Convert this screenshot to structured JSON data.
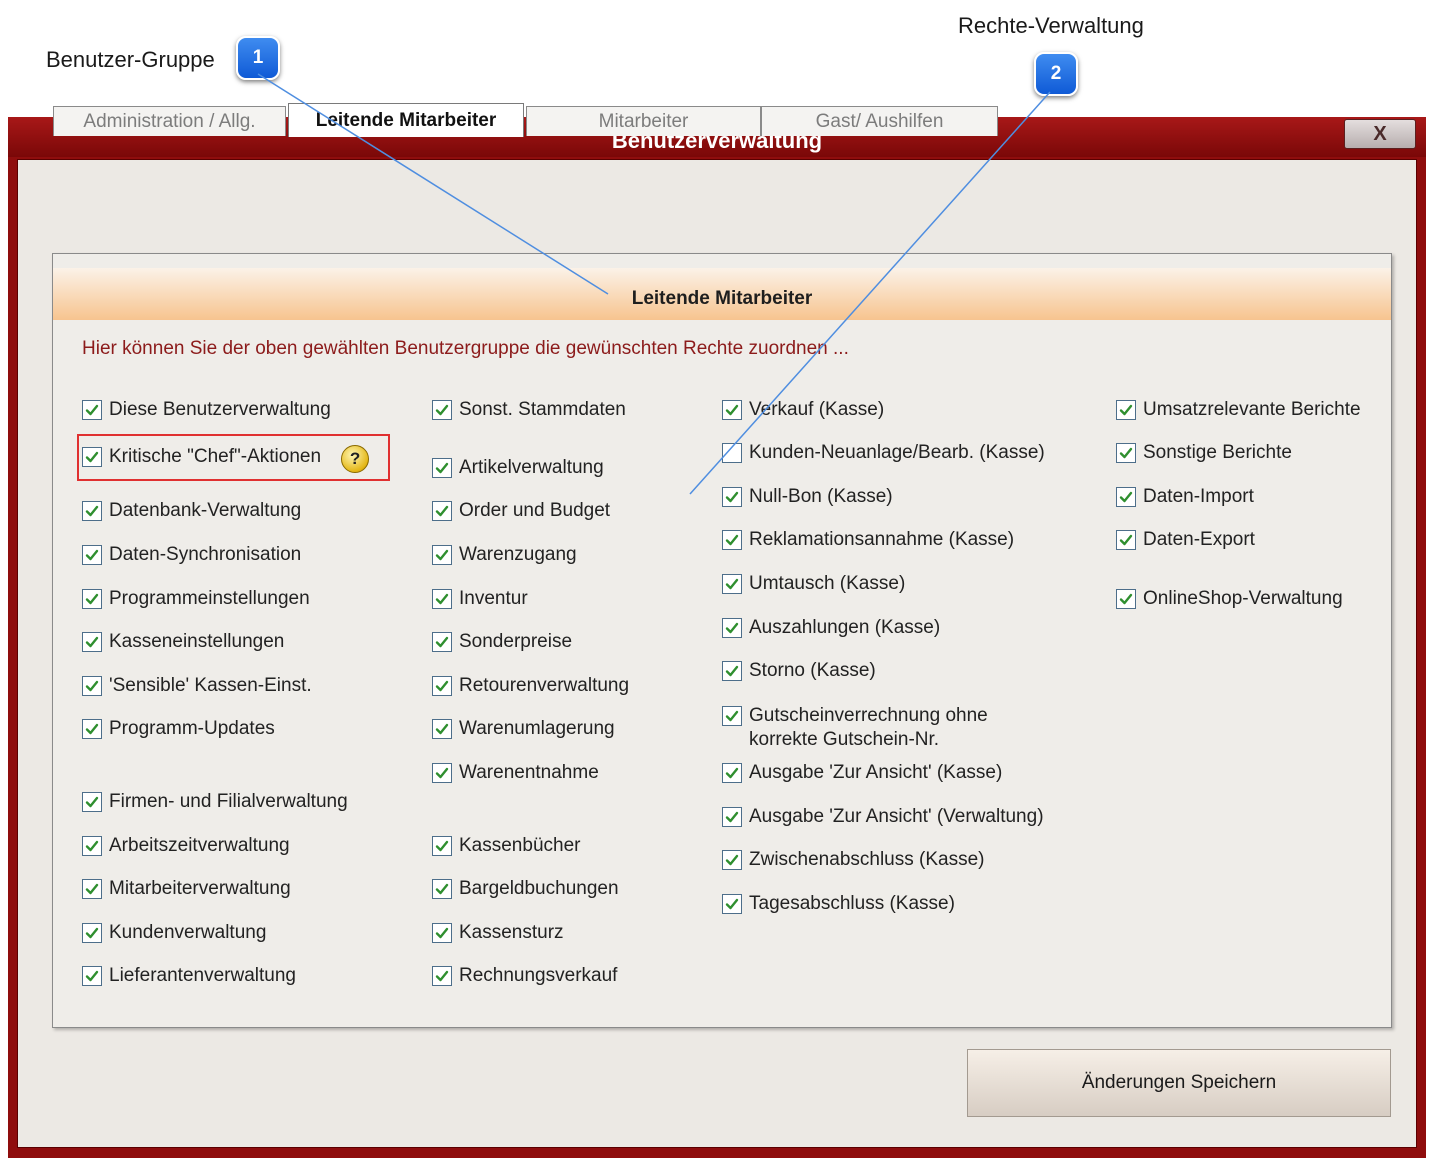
{
  "callouts": [
    {
      "number": "1",
      "label": "Benutzer-Gruppe"
    },
    {
      "number": "2",
      "label": "Rechte-Verwaltung"
    }
  ],
  "window": {
    "title": "Benutzerverwaltung",
    "close_glyph": "X"
  },
  "tabs": [
    {
      "label": "Administration / Allg.",
      "active": false
    },
    {
      "label": "Leitende Mitarbeiter",
      "active": true
    },
    {
      "label": "Mitarbeiter",
      "active": false
    },
    {
      "label": "Gast/ Aushilfen",
      "active": false
    }
  ],
  "panel": {
    "header": "Leitende Mitarbeiter",
    "hint": "Hier können Sie der oben gewählten Benutzergruppe die gewünschten  Rechte zuordnen ..."
  },
  "columns": [
    [
      {
        "label": "Diese Benutzerverwaltung",
        "checked": true
      },
      {
        "label": "Kritische \"Chef\"-Aktionen",
        "checked": true,
        "help_icon": "question-help-icon",
        "highlighted": true
      },
      {
        "label": "Datenbank-Verwaltung",
        "checked": true
      },
      {
        "label": "Daten-Synchronisation",
        "checked": true
      },
      {
        "label": "Programmeinstellungen",
        "checked": true
      },
      {
        "label": "Kasseneinstellungen",
        "checked": true
      },
      {
        "label": "'Sensible' Kassen-Einst.",
        "checked": true
      },
      {
        "label": "Programm-Updates",
        "checked": true
      },
      {
        "label": "Firmen- und Filialverwaltung",
        "checked": true
      },
      {
        "label": "Arbeitszeitverwaltung",
        "checked": true
      },
      {
        "label": "Mitarbeiterverwaltung",
        "checked": true
      },
      {
        "label": "Kundenverwaltung",
        "checked": true
      },
      {
        "label": "Lieferantenverwaltung",
        "checked": true
      }
    ],
    [
      {
        "label": "Sonst. Stammdaten",
        "checked": true
      },
      {
        "label": "Artikelverwaltung",
        "checked": true
      },
      {
        "label": "Order und Budget",
        "checked": true
      },
      {
        "label": "Warenzugang",
        "checked": true
      },
      {
        "label": "Inventur",
        "checked": true
      },
      {
        "label": "Sonderpreise",
        "checked": true
      },
      {
        "label": "Retourenverwaltung",
        "checked": true
      },
      {
        "label": "Warenumlagerung",
        "checked": true
      },
      {
        "label": "Warenentnahme",
        "checked": true
      },
      {
        "label": "Kassenbücher",
        "checked": true
      },
      {
        "label": "Bargeldbuchungen",
        "checked": true
      },
      {
        "label": "Kassensturz",
        "checked": true
      },
      {
        "label": "Rechnungsverkauf",
        "checked": true
      }
    ],
    [
      {
        "label": "Verkauf (Kasse)",
        "checked": true
      },
      {
        "label": "Kunden-Neuanlage/Bearb. (Kasse)",
        "checked": false
      },
      {
        "label": "Null-Bon (Kasse)",
        "checked": true
      },
      {
        "label": "Reklamationsannahme (Kasse)",
        "checked": true
      },
      {
        "label": "Umtausch (Kasse)",
        "checked": true
      },
      {
        "label": "Auszahlungen (Kasse)",
        "checked": true
      },
      {
        "label": "Storno (Kasse)",
        "checked": true
      },
      {
        "label": "Gutscheinverrechnung ohne korrekte Gutschein-Nr.",
        "checked": true
      },
      {
        "label": "Ausgabe 'Zur Ansicht' (Kasse)",
        "checked": true
      },
      {
        "label": "Ausgabe 'Zur Ansicht' (Verwaltung)",
        "checked": true
      },
      {
        "label": "Zwischenabschluss (Kasse)",
        "checked": true
      },
      {
        "label": "Tagesabschluss (Kasse)",
        "checked": true
      }
    ],
    [
      {
        "label": "Umsatzrelevante Berichte",
        "checked": true
      },
      {
        "label": "Sonstige Berichte",
        "checked": true
      },
      {
        "label": "Daten-Import",
        "checked": true
      },
      {
        "label": "Daten-Export",
        "checked": true
      },
      {
        "label": "OnlineShop-Verwaltung",
        "checked": true
      }
    ]
  ],
  "save_button": {
    "label": "Änderungen Speichern"
  },
  "colors": {
    "title_bar": "#9a1010",
    "panel_header_gradient": "#f7c48f",
    "hint_text": "#8c1b1b",
    "checkmark": "#2f8f2f",
    "callout_badge": "#1f6fe0",
    "highlight_box": "#e03030"
  }
}
